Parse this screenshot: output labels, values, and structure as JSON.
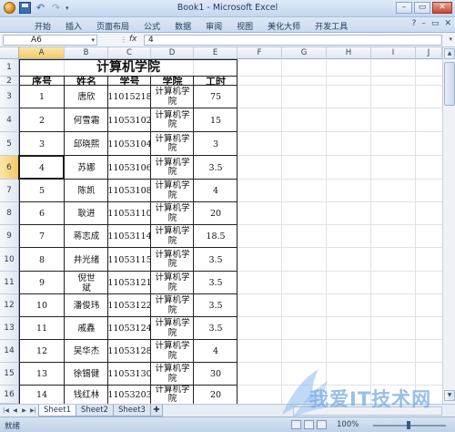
{
  "window": {
    "title": "Book1 - Microsoft Excel",
    "min": "–",
    "max": "▭",
    "close": "✕"
  },
  "ribbon": {
    "tabs": [
      "开始",
      "插入",
      "页面布局",
      "公式",
      "数据",
      "审阅",
      "视图",
      "美化大师",
      "开发工具"
    ],
    "help": "?",
    "minimize": "–",
    "restore": "▭",
    "close": "✕"
  },
  "formula_bar": {
    "name_box": "A6",
    "fx": "fx",
    "value": "4"
  },
  "columns": [
    "A",
    "B",
    "C",
    "D",
    "E",
    "F",
    "G",
    "H",
    "I",
    "J"
  ],
  "rows": [
    "1",
    "2",
    "3",
    "4",
    "5",
    "6",
    "7",
    "8",
    "9",
    "10",
    "11",
    "12",
    "13",
    "14",
    "15",
    "16"
  ],
  "selected": {
    "column": "A",
    "row": "6"
  },
  "table": {
    "title": "计算机学院",
    "headers": [
      "序号",
      "姓名",
      "学号",
      "学院",
      "工时"
    ],
    "rows": [
      {
        "seq": "1",
        "name": "唐欣",
        "id": "11015218",
        "college": "计算机学院",
        "hours": "75"
      },
      {
        "seq": "2",
        "name": "何雪霜",
        "id": "11053102",
        "college": "计算机学院",
        "hours": "15"
      },
      {
        "seq": "3",
        "name": "邱晓熙",
        "id": "11053104",
        "college": "计算机学院",
        "hours": "3"
      },
      {
        "seq": "4",
        "name": "苏娜",
        "id": "11053106",
        "college": "计算机学院",
        "hours": "3.5"
      },
      {
        "seq": "5",
        "name": "陈凯",
        "id": "11053108",
        "college": "计算机学院",
        "hours": "4"
      },
      {
        "seq": "6",
        "name": "耿进",
        "id": "11053110",
        "college": "计算机学院",
        "hours": "20"
      },
      {
        "seq": "7",
        "name": "蒋志成",
        "id": "11053114",
        "college": "计算机学院",
        "hours": "18.5"
      },
      {
        "seq": "8",
        "name": "井光绪",
        "id": "11053115",
        "college": "计算机学院",
        "hours": "3.5"
      },
      {
        "seq": "9",
        "name": "倪世斌",
        "id": "11053121",
        "college": "计算机学院",
        "hours": "3.5"
      },
      {
        "seq": "10",
        "name": "潘俊玮",
        "id": "11053122",
        "college": "计算机学院",
        "hours": "3.5"
      },
      {
        "seq": "11",
        "name": "戚鑫",
        "id": "11053124",
        "college": "计算机学院",
        "hours": "3.5"
      },
      {
        "seq": "12",
        "name": "吴华杰",
        "id": "11053128",
        "college": "计算机学院",
        "hours": "4"
      },
      {
        "seq": "13",
        "name": "徐锡健",
        "id": "11053130",
        "college": "计算机学院",
        "hours": "30"
      },
      {
        "seq": "14",
        "name": "钱红林",
        "id": "11053203",
        "college": "计算机学院",
        "hours": "20"
      }
    ]
  },
  "sheet_tabs": [
    "Sheet1",
    "Sheet2",
    "Sheet3"
  ],
  "status": {
    "ready": "就绪",
    "zoom": "100%"
  },
  "watermark": {
    "text": "我爱IT技术网"
  },
  "colors": {
    "selection_header": "#f4c86a",
    "ribbon": "#cadbf0",
    "watermark": "#78aae1"
  }
}
